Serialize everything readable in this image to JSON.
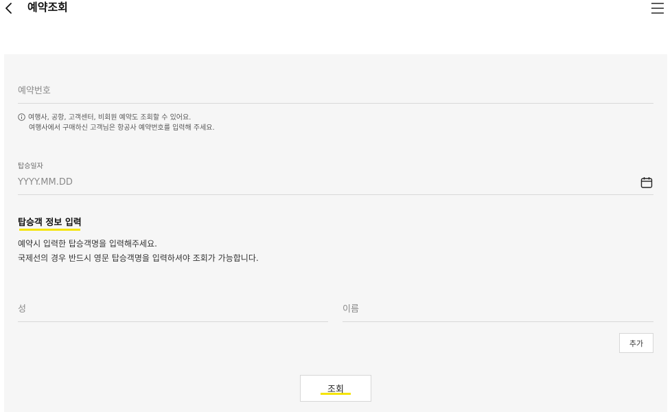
{
  "header": {
    "title": "예약조회",
    "back_icon": "chevron-left-icon",
    "menu_icon": "hamburger-menu-icon"
  },
  "reservation": {
    "placeholder": "예약번호",
    "value": ""
  },
  "notice": {
    "icon": "info-icon",
    "line1": "여행사, 공항, 고객센터, 비회원 예약도 조회할 수 있어요.",
    "line2": "여행사에서 구매하신 고객님은 항공사 예약번호를 입력해 주세요."
  },
  "boarding_date": {
    "label": "탑승일자",
    "placeholder": "YYYY.MM.DD",
    "value": "",
    "icon": "calendar-icon"
  },
  "passenger_section": {
    "title": "탑승객 정보 입력",
    "desc_line1": "예약시 입력한 탑승객명을 입력해주세요.",
    "desc_line2": "국제선의 경우 반드시 영문 탑승객명을 입력하셔야 조회가 가능합니다.",
    "last_name_placeholder": "성",
    "first_name_placeholder": "이름",
    "add_label": "추가"
  },
  "actions": {
    "search_label": "조회"
  },
  "colors": {
    "accent": "#f5e400",
    "panel_bg": "#f6f6f6"
  }
}
